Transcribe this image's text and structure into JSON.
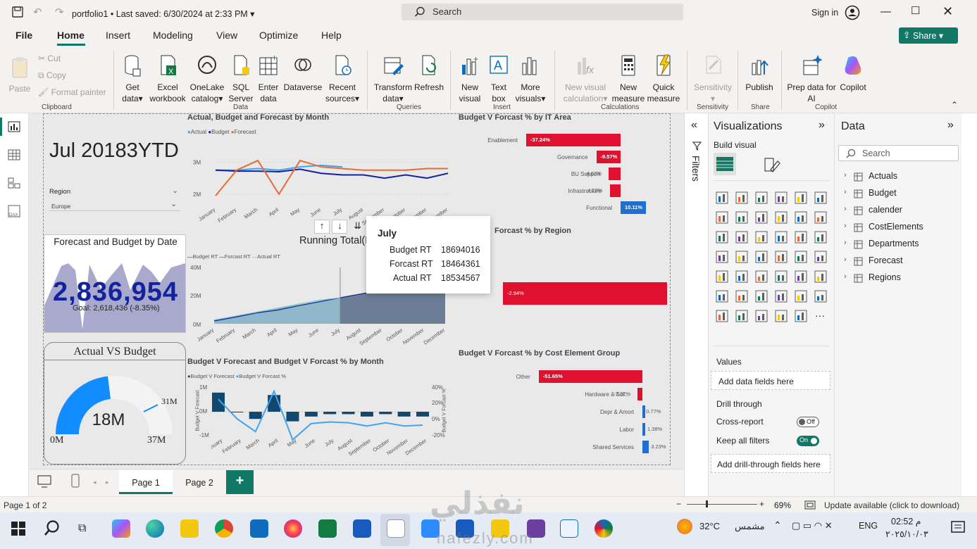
{
  "app": {
    "file_title": "portfolio1",
    "saved": "Last saved: 6/30/2024 at 2:33 PM",
    "search_placeholder": "Search",
    "sign_in": "Sign in"
  },
  "menu": {
    "file": "File",
    "tabs": [
      "Home",
      "Insert",
      "Modeling",
      "View",
      "Optimize",
      "Help"
    ],
    "share": "Share"
  },
  "ribbon": {
    "clipboard": {
      "paste": "Paste",
      "cut": "Cut",
      "copy": "Copy",
      "format_painter": "Format painter",
      "group": "Clipboard"
    },
    "data": {
      "get_data": [
        "Get",
        "data"
      ],
      "excel": [
        "Excel",
        "workbook"
      ],
      "onelake": [
        "OneLake",
        "catalog"
      ],
      "sql": [
        "SQL",
        "Server"
      ],
      "enter": [
        "Enter",
        "data"
      ],
      "dataverse": "Dataverse",
      "recent": [
        "Recent",
        "sources"
      ],
      "group": "Data"
    },
    "queries": {
      "transform": [
        "Transform",
        "data"
      ],
      "refresh": "Refresh",
      "group": "Queries"
    },
    "insert": {
      "new_visual": [
        "New",
        "visual"
      ],
      "text_box": [
        "Text",
        "box"
      ],
      "more_visuals": [
        "More",
        "visuals"
      ],
      "group": "Insert"
    },
    "calculations": {
      "new_visual_calc": [
        "New visual",
        "calculation"
      ],
      "new_measure": [
        "New",
        "measure"
      ],
      "quick_measure": [
        "Quick",
        "measure"
      ],
      "group": "Calculations"
    },
    "sensitivity": {
      "label": "Sensitivity",
      "group": "Sensitivity"
    },
    "share": {
      "publish": "Publish",
      "group": "Share"
    },
    "copilot": {
      "prep": [
        "Prep data for",
        "AI"
      ],
      "copilot": "Copilot",
      "group": "Copilot"
    }
  },
  "report": {
    "kpi_title": "Jul 20183YTD",
    "region_label": "Region",
    "region_value": "Europe",
    "card": {
      "title": "Forecast and Budget by Date",
      "value": "2,836,954",
      "goal": "Goal: 2,618,436 (-8.35%)"
    },
    "gauge": {
      "title": "Actual VS Budget",
      "value": "18M",
      "min": "0M",
      "max": "37M",
      "target": "31M"
    },
    "tooltip": {
      "title": "July",
      "rows": [
        {
          "k": "Budget RT",
          "v": "18694016"
        },
        {
          "k": "Forcast RT",
          "v": "18464361"
        },
        {
          "k": "Actual RT",
          "v": "18534567"
        }
      ]
    },
    "running_total_title": "Running Total(RT)",
    "running_total_legend": [
      "Budget RT",
      "Forcast RT",
      "Actual RT"
    ],
    "running_total_axis": [
      "40M",
      "20M",
      "0M"
    ],
    "it_area": {
      "title": "Budget V Forcast % by IT Area",
      "rows": [
        {
          "cat": "Enablement",
          "val": "-37.24%"
        },
        {
          "cat": "Governance",
          "val": "-9.57%"
        },
        {
          "cat": "BU Support",
          "val": "-4.67%"
        },
        {
          "cat": "Infrastructure",
          "val": "-4.29%"
        },
        {
          "cat": "Functional",
          "val": "10.11%"
        }
      ]
    },
    "region_chart": {
      "title": "Forcast % by Region",
      "val": "-2.94%"
    },
    "cost_element": {
      "title": "Budget V Forcast % by Cost Element Group",
      "rows": [
        {
          "cat": "Other",
          "val": "-51.65%"
        },
        {
          "cat": "Hardware & Sof...",
          "val": "-2.32%"
        },
        {
          "cat": "Depr & Amort",
          "val": "0.77%"
        },
        {
          "cat": "Labor",
          "val": "1.38%"
        },
        {
          "cat": "Shared Services",
          "val": "3.23%"
        }
      ]
    },
    "combo": {
      "title": "Budget V Forecast and Budget V Forcast % by Month",
      "legend": [
        "Budget V Forecast",
        "Budget V Forcast %"
      ],
      "left_axis": [
        "1M",
        "0M",
        "-1M"
      ],
      "right_axis": [
        "40%",
        "20%",
        "0%",
        "-20%"
      ],
      "left_label": "Budget V Forecast",
      "right_label": "Budget V Forcast %"
    }
  },
  "chart_data": [
    {
      "type": "line",
      "title": "Actual, Budget and Forecast by Month",
      "categories": [
        "January",
        "February",
        "March",
        "April",
        "May",
        "June",
        "July",
        "August",
        "September",
        "October",
        "November",
        "December"
      ],
      "yticks": [
        "3M",
        "2M"
      ],
      "ylim": [
        1.8,
        3.6
      ],
      "series": [
        {
          "name": "Actual",
          "color": "#41a5ee",
          "values": [
            2.75,
            2.75,
            2.8,
            2.75,
            2.85,
            2.9,
            2.85,
            null,
            null,
            null,
            null,
            null
          ]
        },
        {
          "name": "Budget",
          "color": "#12239e",
          "values": [
            2.75,
            2.72,
            2.72,
            2.7,
            2.78,
            2.65,
            2.6,
            2.6,
            2.5,
            2.6,
            2.5,
            2.65
          ]
        },
        {
          "name": "Forecast",
          "color": "#e66c37",
          "values": [
            1.95,
            2.75,
            3.05,
            2.0,
            3.05,
            2.85,
            2.8,
            2.75,
            2.75,
            2.75,
            2.8,
            2.8
          ]
        }
      ]
    },
    {
      "type": "area",
      "title": "Running Total(RT)",
      "categories": [
        "January",
        "February",
        "March",
        "April",
        "May",
        "June",
        "July",
        "August",
        "September",
        "October",
        "November",
        "December"
      ],
      "ylim": [
        0,
        40
      ],
      "yunit": "M",
      "series": [
        {
          "name": "Budget RT",
          "values": [
            2.7,
            5.4,
            8.1,
            10.8,
            13.5,
            16.2,
            18.7,
            21.3,
            23.9,
            26.5,
            29.0,
            31.5
          ]
        },
        {
          "name": "Forcast RT",
          "values": [
            2.0,
            4.7,
            7.7,
            9.7,
            12.8,
            15.6,
            18.5,
            21.2,
            24.0,
            26.7,
            29.5,
            32.3
          ]
        },
        {
          "name": "Actual RT",
          "values": [
            2.7,
            5.4,
            8.2,
            11.0,
            13.9,
            16.7,
            18.5,
            null,
            null,
            null,
            null,
            null
          ]
        }
      ]
    },
    {
      "type": "bar",
      "title": "Budget V Forecast and Budget V Forcast % by Month",
      "categories": [
        "January",
        "February",
        "March",
        "April",
        "May",
        "June",
        "July",
        "August",
        "September",
        "October",
        "November",
        "December"
      ],
      "series": [
        {
          "name": "Budget V Forecast",
          "values": [
            0.8,
            0.0,
            -0.3,
            0.7,
            -0.4,
            -0.2,
            -0.1,
            -0.1,
            -0.2,
            -0.1,
            -0.2,
            -0.2
          ]
        },
        {
          "name": "Budget V Forcast %",
          "values": [
            25,
            1,
            -15,
            35,
            -25,
            -5,
            -3,
            -4,
            -8,
            -4,
            -8,
            -7
          ]
        }
      ]
    }
  ],
  "panes": {
    "filters": "Filters",
    "viz_title": "Visualizations",
    "build_visual": "Build visual",
    "values": "Values",
    "add_data": "Add data fields here",
    "drill_through": "Drill through",
    "cross_report": "Cross-report",
    "cross_state": "Off",
    "keep_filters": "Keep all filters",
    "keep_state": "On",
    "add_drill": "Add drill-through fields here",
    "data_title": "Data",
    "data_search": "Search",
    "tables": [
      "Actuals",
      "Budget",
      "calender",
      "CostElements",
      "Departments",
      "Forecast",
      "Regions"
    ]
  },
  "pages": {
    "tabs": [
      "Page 1",
      "Page 2"
    ],
    "add": "+"
  },
  "status": {
    "page": "Page 1 of 2",
    "zoom": "69%",
    "update": "Update available (click to download)"
  },
  "taskbar": {
    "weather": "32°C",
    "weather_label": "مشمس",
    "lang": "ENG",
    "time": "02:52 م",
    "date": "٢٠٢٥/١٠/٠٣"
  },
  "watermark": {
    "arabic": "نفذلي",
    "latin": "nafezly.com"
  },
  "colors": {
    "accent": "#117865",
    "red": "#e0102f",
    "blue": "#1f6fd1",
    "navy": "#12239e",
    "orange": "#e66c37"
  }
}
